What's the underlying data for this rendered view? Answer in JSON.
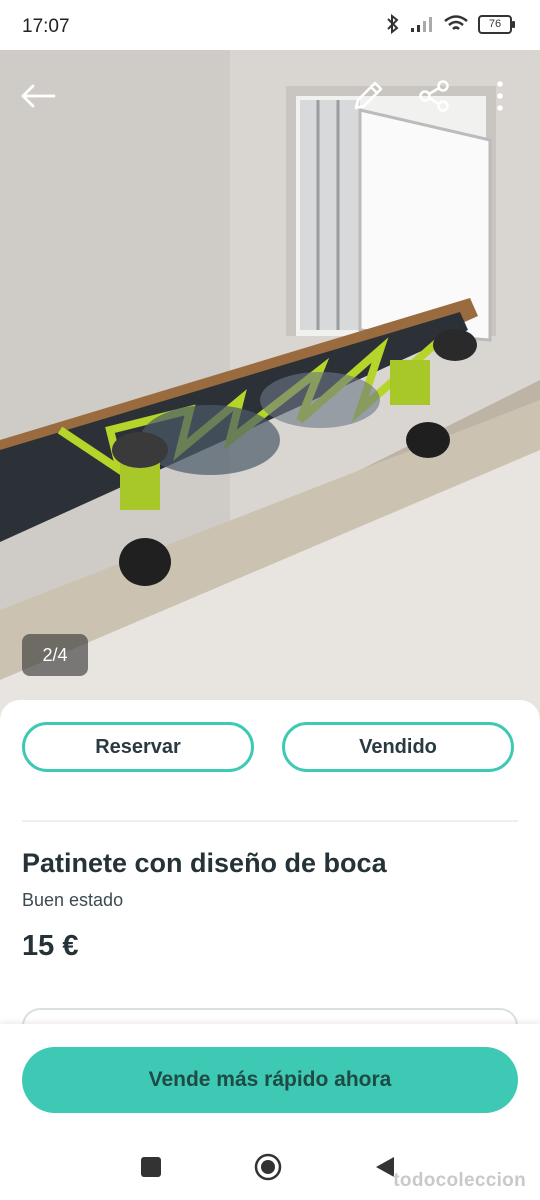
{
  "status_bar": {
    "time": "17:07",
    "battery": "76"
  },
  "photo": {
    "counter": "2/4"
  },
  "actions": {
    "reserve_label": "Reservar",
    "sold_label": "Vendido"
  },
  "product": {
    "title": "Patinete con diseño de boca",
    "condition": "Buen estado",
    "price": "15 €"
  },
  "cta": {
    "label": "Vende más rápido ahora"
  },
  "watermark": "todocoleccion",
  "colors": {
    "accent": "#3dc9b3",
    "text_dark": "#253238"
  }
}
